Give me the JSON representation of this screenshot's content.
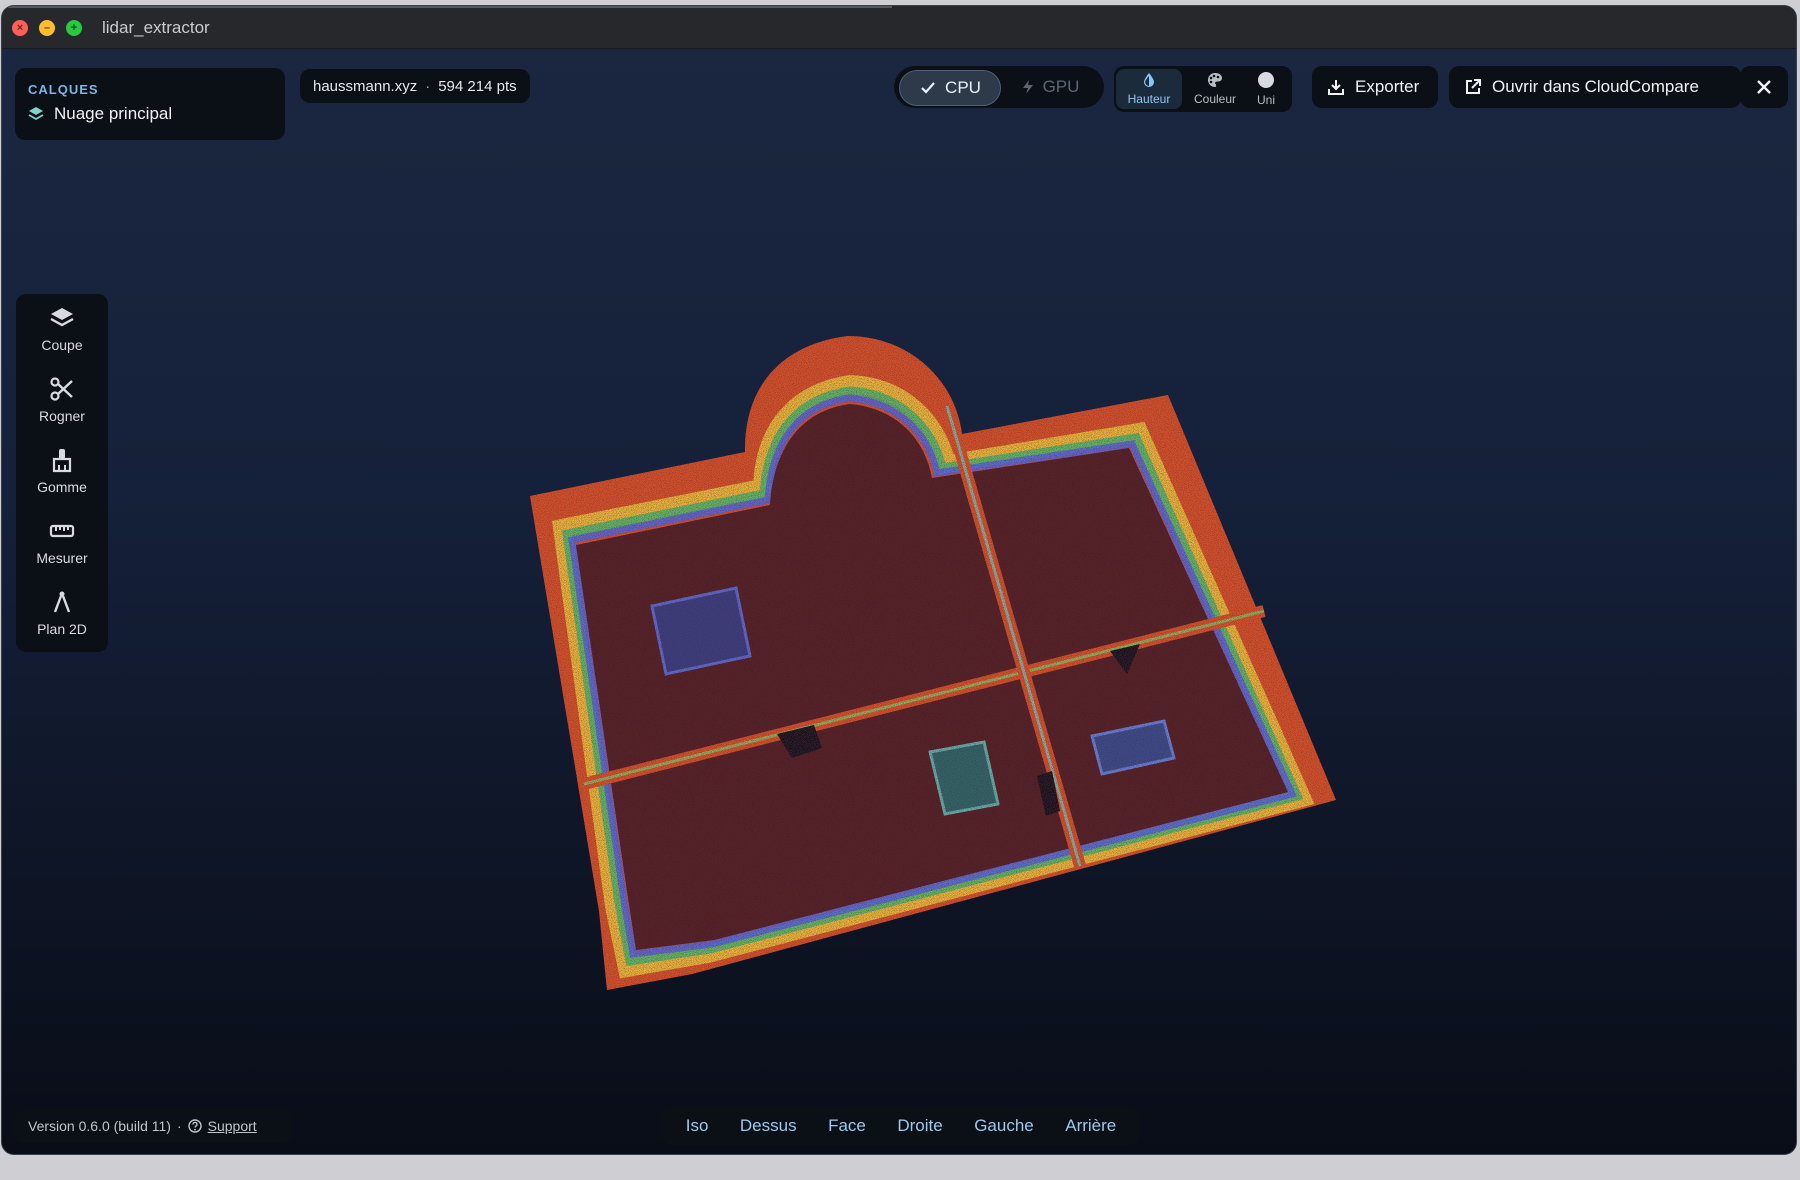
{
  "window": {
    "title": "lidar_extractor"
  },
  "layers": {
    "title": "CALQUES",
    "items": [
      {
        "label": "Nuage principal"
      }
    ]
  },
  "file": {
    "name": "haussmann.xyz",
    "separator": "·",
    "points": "594 214 pts"
  },
  "compute": {
    "cpu_label": "CPU",
    "gpu_label": "GPU",
    "selected": "CPU"
  },
  "color_mode": {
    "options": [
      {
        "label": "Hauteur",
        "icon": "drop-icon"
      },
      {
        "label": "Couleur",
        "icon": "palette-icon"
      },
      {
        "label": "Uni",
        "icon": "circle-icon"
      }
    ],
    "selected": "Hauteur"
  },
  "actions": {
    "export_label": "Exporter",
    "open_label": "Ouvrir dans CloudCompare"
  },
  "tools": [
    {
      "label": "Coupe",
      "icon": "layers-icon"
    },
    {
      "label": "Rogner",
      "icon": "scissors-icon"
    },
    {
      "label": "Gomme",
      "icon": "eraser-icon"
    },
    {
      "label": "Mesurer",
      "icon": "ruler-icon"
    },
    {
      "label": "Plan 2D",
      "icon": "compass-icon"
    }
  ],
  "footer": {
    "version": "Version 0.6.0  (build 11)",
    "separator": "·",
    "support_label": "Support"
  },
  "views": [
    "Iso",
    "Dessus",
    "Face",
    "Droite",
    "Gauche",
    "Arrière"
  ],
  "colors": {
    "accent": "#7fb4e6",
    "panel": "#0b0f16",
    "floor": "#5a1a12",
    "wall": "#e0461d"
  }
}
